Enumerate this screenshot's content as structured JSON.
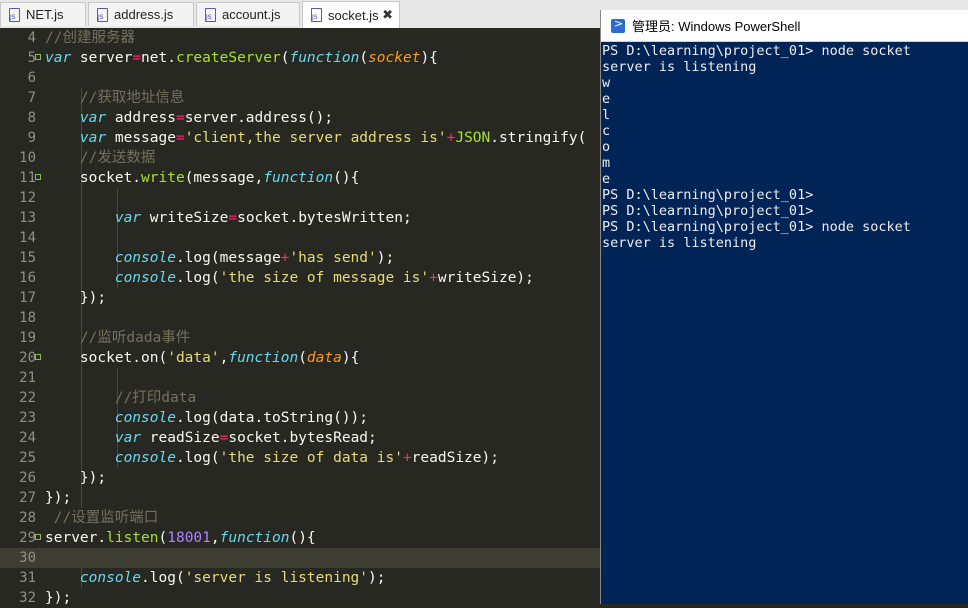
{
  "tabs": [
    {
      "label": "NET.js",
      "active": false
    },
    {
      "label": "address.js",
      "active": false
    },
    {
      "label": "account.js",
      "active": false
    },
    {
      "label": "socket.js",
      "active": true
    }
  ],
  "tab_close_glyph": "✖",
  "editor": {
    "current_line": 30,
    "lines": [
      {
        "n": "4",
        "fold": false,
        "tokens": [
          [
            "cmt",
            "//创建服务器"
          ]
        ]
      },
      {
        "n": "5",
        "fold": true,
        "tokens": [
          [
            "kw",
            "var"
          ],
          [
            "plain",
            " server"
          ],
          [
            "op",
            "="
          ],
          [
            "plain",
            "net."
          ],
          [
            "fn",
            "createServer"
          ],
          [
            "plain",
            "("
          ],
          [
            "kw",
            "function"
          ],
          [
            "plain",
            "("
          ],
          [
            "param",
            "socket"
          ],
          [
            "plain",
            "){"
          ]
        ]
      },
      {
        "n": "6",
        "fold": false,
        "tokens": []
      },
      {
        "n": "7",
        "fold": false,
        "tokens": [
          [
            "plain",
            "    "
          ],
          [
            "cmt",
            "//获取地址信息"
          ]
        ]
      },
      {
        "n": "8",
        "fold": false,
        "tokens": [
          [
            "plain",
            "    "
          ],
          [
            "kw",
            "var"
          ],
          [
            "plain",
            " address"
          ],
          [
            "op",
            "="
          ],
          [
            "plain",
            "server.address();"
          ]
        ]
      },
      {
        "n": "9",
        "fold": false,
        "tokens": [
          [
            "plain",
            "    "
          ],
          [
            "kw",
            "var"
          ],
          [
            "plain",
            " message"
          ],
          [
            "op",
            "="
          ],
          [
            "str",
            "'client,the server address is'"
          ],
          [
            "op",
            "+"
          ],
          [
            "fn",
            "JSON"
          ],
          [
            "plain",
            ".stringify("
          ]
        ]
      },
      {
        "n": "10",
        "fold": false,
        "tokens": [
          [
            "plain",
            "    "
          ],
          [
            "cmt",
            "//发送数据"
          ]
        ]
      },
      {
        "n": "11",
        "fold": true,
        "tokens": [
          [
            "plain",
            "    socket."
          ],
          [
            "fn",
            "write"
          ],
          [
            "plain",
            "(message,"
          ],
          [
            "kw",
            "function"
          ],
          [
            "plain",
            "(){"
          ]
        ]
      },
      {
        "n": "12",
        "fold": false,
        "tokens": []
      },
      {
        "n": "13",
        "fold": false,
        "tokens": [
          [
            "plain",
            "        "
          ],
          [
            "kw",
            "var"
          ],
          [
            "plain",
            " writeSize"
          ],
          [
            "op",
            "="
          ],
          [
            "plain",
            "socket.bytesWritten;"
          ]
        ]
      },
      {
        "n": "14",
        "fold": false,
        "tokens": []
      },
      {
        "n": "15",
        "fold": false,
        "tokens": [
          [
            "plain",
            "        "
          ],
          [
            "kw",
            "console"
          ],
          [
            "plain",
            ".log(message"
          ],
          [
            "op",
            "+"
          ],
          [
            "str",
            "'has send'"
          ],
          [
            "plain",
            ");"
          ]
        ]
      },
      {
        "n": "16",
        "fold": false,
        "tokens": [
          [
            "plain",
            "        "
          ],
          [
            "kw",
            "console"
          ],
          [
            "plain",
            ".log("
          ],
          [
            "str",
            "'the size of message is'"
          ],
          [
            "op",
            "+"
          ],
          [
            "plain",
            "writeSize);"
          ]
        ]
      },
      {
        "n": "17",
        "fold": false,
        "tokens": [
          [
            "plain",
            "    });"
          ]
        ]
      },
      {
        "n": "18",
        "fold": false,
        "tokens": []
      },
      {
        "n": "19",
        "fold": false,
        "tokens": [
          [
            "plain",
            "    "
          ],
          [
            "cmt",
            "//监听dada事件"
          ]
        ]
      },
      {
        "n": "20",
        "fold": true,
        "tokens": [
          [
            "plain",
            "    socket.on("
          ],
          [
            "str",
            "'data'"
          ],
          [
            "plain",
            ","
          ],
          [
            "kw",
            "function"
          ],
          [
            "plain",
            "("
          ],
          [
            "param",
            "data"
          ],
          [
            "plain",
            "){"
          ]
        ]
      },
      {
        "n": "21",
        "fold": false,
        "tokens": []
      },
      {
        "n": "22",
        "fold": false,
        "tokens": [
          [
            "plain",
            "        "
          ],
          [
            "cmt",
            "//打印data"
          ]
        ]
      },
      {
        "n": "23",
        "fold": false,
        "tokens": [
          [
            "plain",
            "        "
          ],
          [
            "kw",
            "console"
          ],
          [
            "plain",
            ".log(data.toString());"
          ]
        ]
      },
      {
        "n": "24",
        "fold": false,
        "tokens": [
          [
            "plain",
            "        "
          ],
          [
            "kw",
            "var"
          ],
          [
            "plain",
            " readSize"
          ],
          [
            "op",
            "="
          ],
          [
            "plain",
            "socket.bytesRead;"
          ]
        ]
      },
      {
        "n": "25",
        "fold": false,
        "tokens": [
          [
            "plain",
            "        "
          ],
          [
            "kw",
            "console"
          ],
          [
            "plain",
            ".log("
          ],
          [
            "str",
            "'the size of data is'"
          ],
          [
            "op",
            "+"
          ],
          [
            "plain",
            "readSize);"
          ]
        ]
      },
      {
        "n": "26",
        "fold": false,
        "tokens": [
          [
            "plain",
            "    });"
          ]
        ]
      },
      {
        "n": "27",
        "fold": false,
        "tokens": [
          [
            "plain",
            "});"
          ]
        ]
      },
      {
        "n": "28",
        "fold": false,
        "tokens": [
          [
            "plain",
            " "
          ],
          [
            "cmt",
            "//设置监听端口"
          ]
        ]
      },
      {
        "n": "29",
        "fold": true,
        "tokens": [
          [
            "plain",
            "server."
          ],
          [
            "fn",
            "listen"
          ],
          [
            "plain",
            "("
          ],
          [
            "num",
            "18001"
          ],
          [
            "plain",
            ","
          ],
          [
            "kw",
            "function"
          ],
          [
            "plain",
            "(){"
          ]
        ]
      },
      {
        "n": "30",
        "fold": false,
        "tokens": []
      },
      {
        "n": "31",
        "fold": false,
        "tokens": [
          [
            "plain",
            "    "
          ],
          [
            "kw",
            "console"
          ],
          [
            "plain",
            ".log("
          ],
          [
            "str",
            "'server is listening'"
          ],
          [
            "plain",
            ");"
          ]
        ]
      },
      {
        "n": "32",
        "fold": false,
        "tokens": [
          [
            "plain",
            "});"
          ]
        ]
      }
    ]
  },
  "powershell": {
    "title": "管理员: Windows PowerShell",
    "lines": [
      "PS D:\\learning\\project_01> node socket",
      "server is listening",
      "w",
      "e",
      "l",
      "c",
      "o",
      "m",
      "e",
      "PS D:\\learning\\project_01>",
      "PS D:\\learning\\project_01>",
      "PS D:\\learning\\project_01> node socket",
      "server is listening"
    ]
  },
  "colors": {
    "editor_bg": "#272822",
    "comment": "#75715e",
    "keyword": "#66d9ef",
    "operator": "#f92672",
    "string": "#e6db74",
    "function": "#a6e22e",
    "param": "#fd971f",
    "number": "#ae81ff",
    "powershell_bg": "#012456"
  }
}
